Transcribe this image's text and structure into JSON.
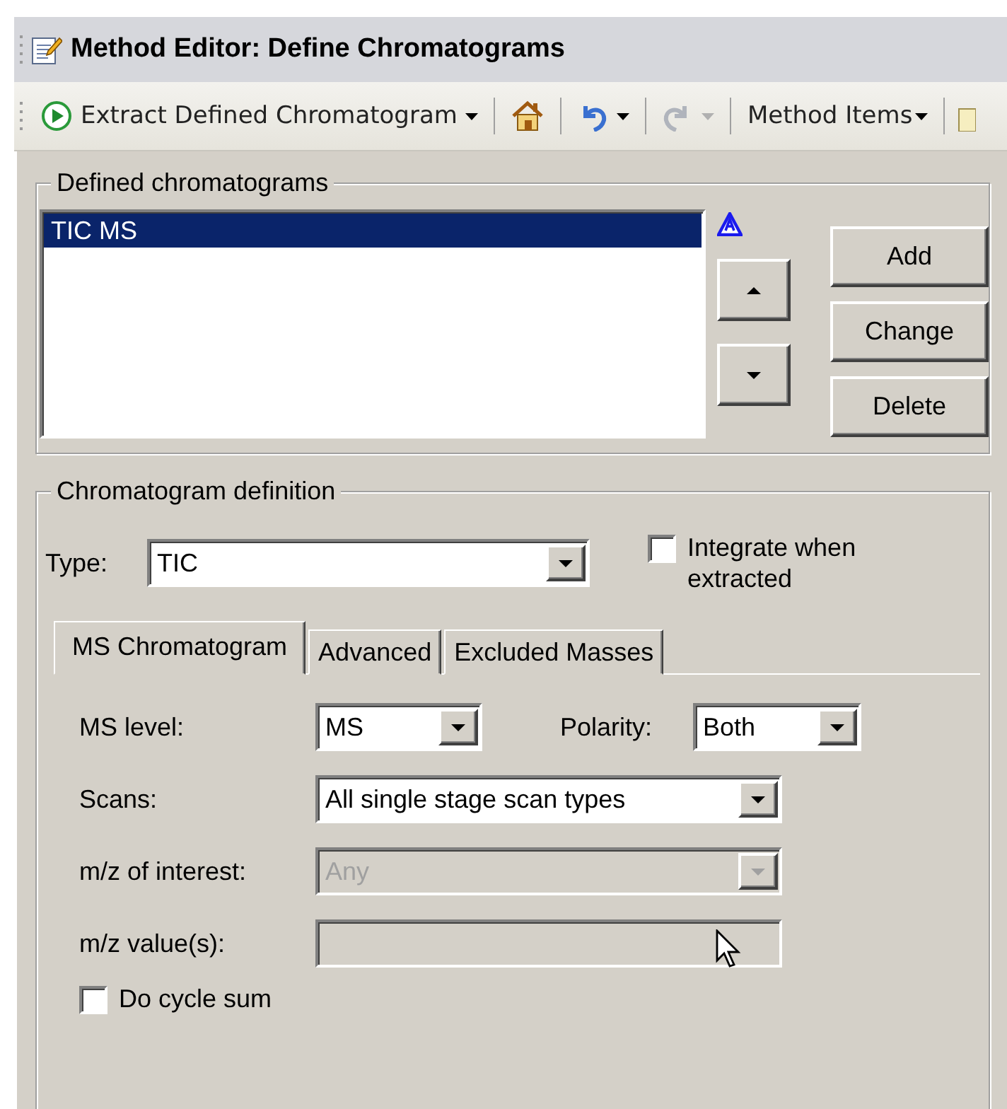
{
  "window": {
    "title": "Method Editor: Define Chromatograms"
  },
  "toolbar": [
    {
      "kind": "command",
      "label": "Extract Defined Chromatogram"
    },
    {
      "kind": "home"
    },
    {
      "kind": "undo",
      "disabled": false
    },
    {
      "kind": "redo",
      "disabled": true
    },
    {
      "kind": "menu",
      "label": "Method Items"
    },
    {
      "kind": "clipped"
    }
  ],
  "defined_chromatograms": {
    "title": "Defined chromatograms",
    "items": [
      {
        "label": "TIC MS",
        "selected": true
      }
    ],
    "buttons": [
      "Add",
      "Change",
      "Delete"
    ]
  },
  "chromatogram_definition": {
    "title": "Chromatogram definition",
    "type": {
      "label": "Type:",
      "value": "TIC",
      "disabled": false
    },
    "integrate": {
      "label": "Integrate when extracted",
      "checked": false
    },
    "tabs": [
      {
        "label": "MS Chromatogram",
        "selected": true
      },
      {
        "label": "Advanced",
        "selected": false
      },
      {
        "label": "Excluded Masses",
        "selected": false
      }
    ],
    "ms_level": {
      "label": "MS level:",
      "value": "MS",
      "disabled": false
    },
    "polarity": {
      "label": "Polarity:",
      "value": "Both",
      "disabled": false
    },
    "scans": {
      "label": "Scans:",
      "value": "All single stage scan types",
      "disabled": false
    },
    "mz_of_interest": {
      "label": "m/z of interest:",
      "value": "Any",
      "disabled": true
    },
    "mz_values": {
      "label": "m/z value(s):",
      "disabled": true
    },
    "cycle_sum": {
      "label": "Do cycle sum",
      "checked": false
    }
  }
}
